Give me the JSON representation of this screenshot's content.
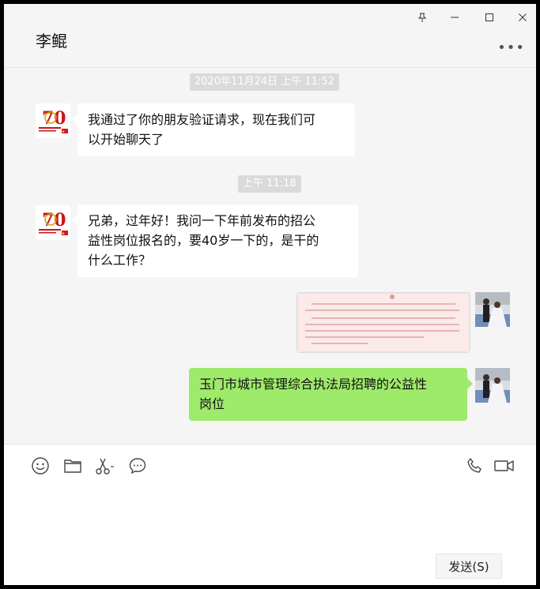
{
  "window": {
    "title": "李鲲"
  },
  "header": {
    "more_icon": "more-horizontal-icon"
  },
  "messages": [
    {
      "type": "timestamp",
      "text": "2020年11月24日 上午 11:52"
    },
    {
      "type": "text",
      "side": "left",
      "text_line1": "我通过了你的朋友验证请求，现在我们可",
      "text_line2": "以开始聊天了"
    },
    {
      "type": "timestamp",
      "text": "上午 11:18"
    },
    {
      "type": "text",
      "side": "left",
      "text_line1": "兄弟，过年好！我问一下年前发布的招公",
      "text_line2": "益性岗位报名的，要40岁一下的，是干的",
      "text_line3": "什么工作？"
    },
    {
      "type": "image",
      "side": "right"
    },
    {
      "type": "text",
      "side": "right",
      "text_line1": "玉门市城市管理综合执法局招聘的公益性",
      "text_line2": "岗位"
    }
  ],
  "input": {
    "toolbar": [
      "emoji-icon",
      "folder-icon",
      "scissors-icon",
      "chat-bubble-icon",
      "phone-icon",
      "video-icon"
    ],
    "send_label": "发送(S)"
  },
  "colors": {
    "bubble_self": "#9eea6a",
    "bubble_other": "#ffffff",
    "background": "#f5f5f5"
  }
}
